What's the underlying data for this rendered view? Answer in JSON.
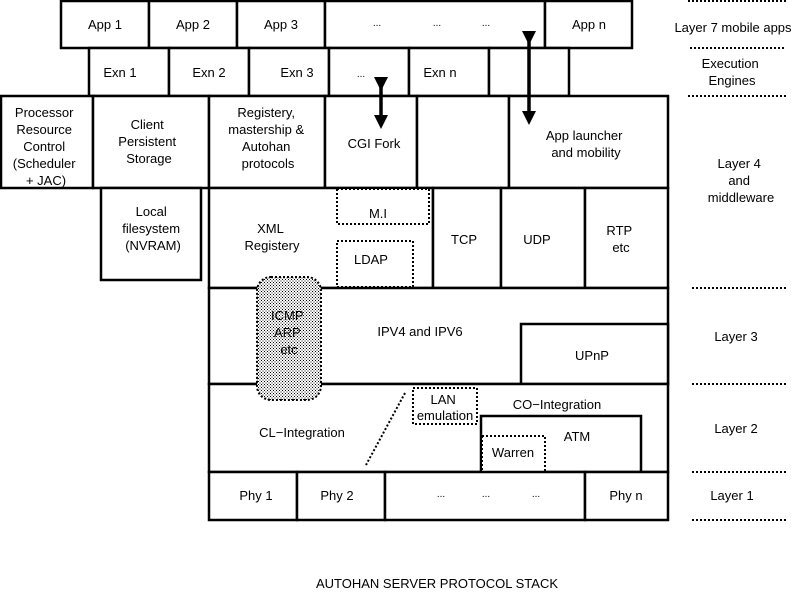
{
  "title": "AUTOHAN SERVER PROTOCOL STACK",
  "layers": {
    "layer7": "Layer 7 mobile apps",
    "exec": [
      "Execution",
      "Engines"
    ],
    "layer4": [
      "Layer 4",
      "and",
      "middleware"
    ],
    "layer3": "Layer 3",
    "layer2": "Layer 2",
    "layer1": "Layer 1"
  },
  "apps": {
    "app1": "App 1",
    "app2": "App 2",
    "app3": "App 3",
    "ellipsis": [
      "...",
      "...",
      "..."
    ],
    "appn": "App n"
  },
  "engines": {
    "exn1": "Exn 1",
    "exn2": "Exn 2",
    "exn3": "Exn 3",
    "ellipsis": "...",
    "exnn": "Exn n"
  },
  "middleware_top": {
    "processor": [
      "Processor",
      "Resource",
      "Control",
      "(Scheduler",
      "+ JAC)"
    ],
    "storage": [
      "Client",
      "Persistent",
      "Storage"
    ],
    "registery": [
      "Registery,",
      "mastership &",
      "Autohan",
      "protocols"
    ],
    "cgi": "CGI Fork",
    "launcher": [
      "App launcher",
      "and mobility"
    ]
  },
  "local_fs": [
    "Local",
    "filesystem",
    "(NVRAM)"
  ],
  "transport": {
    "xml": [
      "XML",
      "Registery"
    ],
    "mi": "M.I",
    "ldap": "LDAP",
    "tcp": "TCP",
    "udp": "UDP",
    "rtp": [
      "RTP",
      "etc"
    ]
  },
  "network": {
    "icmp": [
      "ICMP",
      "ARP",
      "etc"
    ],
    "ip": "IPV4 and IPV6",
    "upnp": "UPnP"
  },
  "link": {
    "cl": "CL−Integration",
    "lan": [
      "LAN",
      "emulation"
    ],
    "co": "CO−Integration",
    "atm": "ATM",
    "warren": "Warren"
  },
  "physical": {
    "phy1": "Phy 1",
    "phy2": "Phy 2",
    "ellipsis": [
      "...",
      "...",
      "..."
    ],
    "phyn": "Phy n"
  }
}
